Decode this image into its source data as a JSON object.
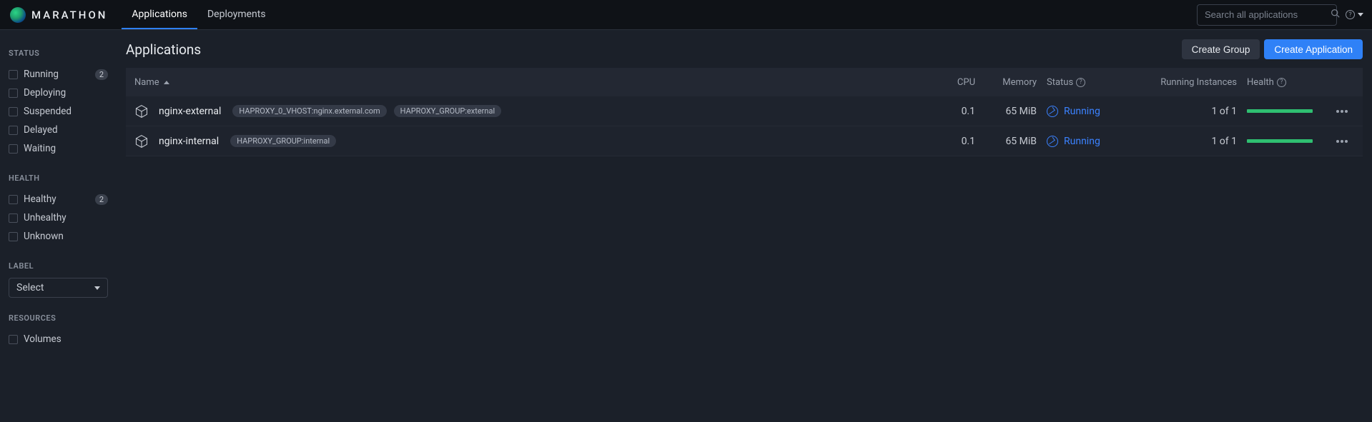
{
  "brand": "MARATHON",
  "nav": {
    "applications": "Applications",
    "deployments": "Deployments"
  },
  "search": {
    "placeholder": "Search all applications"
  },
  "page": {
    "title": "Applications"
  },
  "buttons": {
    "create_group": "Create Group",
    "create_app": "Create Application"
  },
  "sidebar": {
    "status_title": "STATUS",
    "status": [
      {
        "label": "Running",
        "count": "2"
      },
      {
        "label": "Deploying",
        "count": ""
      },
      {
        "label": "Suspended",
        "count": ""
      },
      {
        "label": "Delayed",
        "count": ""
      },
      {
        "label": "Waiting",
        "count": ""
      }
    ],
    "health_title": "HEALTH",
    "health": [
      {
        "label": "Healthy",
        "count": "2"
      },
      {
        "label": "Unhealthy",
        "count": ""
      },
      {
        "label": "Unknown",
        "count": ""
      }
    ],
    "label_title": "LABEL",
    "label_select": "Select",
    "resources_title": "RESOURCES",
    "resources": [
      {
        "label": "Volumes"
      }
    ]
  },
  "table": {
    "headers": {
      "name": "Name",
      "cpu": "CPU",
      "memory": "Memory",
      "status": "Status",
      "instances": "Running Instances",
      "health": "Health"
    },
    "rows": [
      {
        "name": "nginx-external",
        "tags": [
          "HAPROXY_0_VHOST:nginx.external.com",
          "HAPROXY_GROUP:external"
        ],
        "cpu": "0.1",
        "memory": "65 MiB",
        "status": "Running",
        "instances": "1 of 1"
      },
      {
        "name": "nginx-internal",
        "tags": [
          "HAPROXY_GROUP:internal"
        ],
        "cpu": "0.1",
        "memory": "65 MiB",
        "status": "Running",
        "instances": "1 of 1"
      }
    ]
  }
}
